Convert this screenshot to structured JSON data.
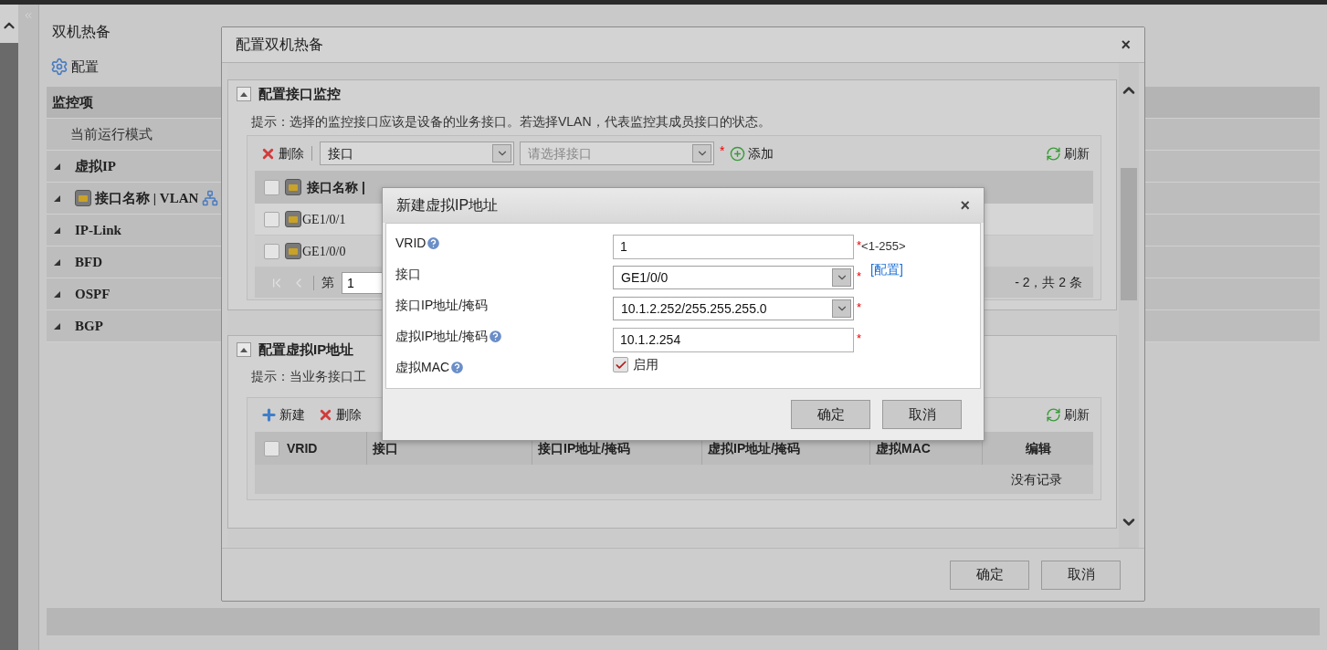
{
  "main": {
    "title": "双机热备",
    "toolbar": {
      "label": "配置"
    },
    "nav": [
      {
        "label": "监控项",
        "kind": "header"
      },
      {
        "label": "当前运行模式",
        "kind": "item"
      },
      {
        "label": "虚拟IP",
        "kind": "group"
      },
      {
        "label": "接口名称 | VLAN",
        "kind": "group_icons"
      },
      {
        "label": "IP-Link",
        "kind": "group"
      },
      {
        "label": "BFD",
        "kind": "group"
      },
      {
        "label": "OSPF",
        "kind": "group"
      },
      {
        "label": "BGP",
        "kind": "group"
      }
    ]
  },
  "dialog": {
    "title": "配置双机热备",
    "close": "×",
    "monitor": {
      "title": "配置接口监控",
      "hint": "提示：选择的监控接口应该是设备的业务接口。若选择VLAN，代表监控其成员接口的状态。",
      "toolbar": {
        "delete": "删除",
        "type_select": "接口",
        "port_select": {
          "placeholder": "请选择接口"
        },
        "required_mark": "*",
        "add": "添加",
        "refresh": "刷新"
      },
      "header": {
        "checked": false,
        "column": "接口名称 |"
      },
      "rows": [
        {
          "checked": false,
          "name": "GE1/0/1"
        },
        {
          "checked": false,
          "name": "GE1/0/0"
        }
      ],
      "pager": {
        "page_label": "第",
        "page": "1",
        "summary": "- 2，共 2 条"
      }
    },
    "vip": {
      "title": "配置虚拟IP地址",
      "hint": "提示：当业务接口工",
      "toolbar": {
        "new": "新建",
        "delete": "删除",
        "refresh": "刷新"
      },
      "header_checked": false,
      "columns": [
        "VRID",
        "接口",
        "接口IP地址/掩码",
        "虚拟IP地址/掩码",
        "虚拟MAC",
        "编辑"
      ],
      "empty": "没有记录"
    },
    "buttons": [
      "确定",
      "取消"
    ]
  },
  "popup": {
    "title": "新建虚拟IP地址",
    "close": "×",
    "fields": [
      {
        "kind": "input",
        "label": "VRID",
        "help": true,
        "value": "1",
        "mark": "*",
        "hint": "<1-255>"
      },
      {
        "kind": "select",
        "label": "接口",
        "help": false,
        "value": "GE1/0/0",
        "mark": "*",
        "link": "[配置]"
      },
      {
        "kind": "select",
        "label": "接口IP地址/掩码",
        "help": false,
        "value": "10.1.2.252/255.255.255.0",
        "mark": "*"
      },
      {
        "kind": "input",
        "label": "虚拟IP地址/掩码",
        "help": true,
        "value": "10.1.2.254",
        "mark": "*"
      },
      {
        "kind": "checkbox",
        "label": "虚拟MAC",
        "help": true,
        "checked": true,
        "text": "启用"
      }
    ],
    "buttons": [
      "确定",
      "取消"
    ]
  }
}
